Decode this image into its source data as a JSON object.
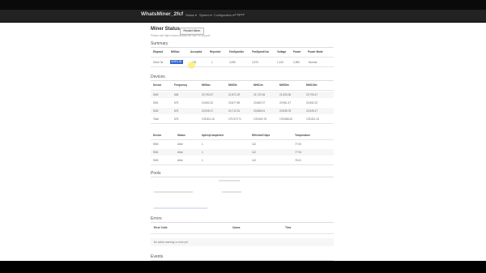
{
  "navbar": {
    "brand": "WhatsMiner_2fcf",
    "items": [
      "Status ▾",
      "System ▾",
      "Configuration ▾",
      "Logout"
    ]
  },
  "header": {
    "title": "Miner Status",
    "restart_label": "Restart Miner",
    "note": "Please visit https://www.whatsminer.com for support"
  },
  "summary": {
    "title": "Summary",
    "columns": [
      "Elapsed",
      "MHSav",
      "Accepted",
      "Rejected",
      "FanSpeedIn",
      "FanSpeedOut",
      "Voltage",
      "Power",
      "Power Mode"
    ],
    "row": [
      "0h1m 3s",
      "62901.81",
      "153",
      "1",
      "3,090",
      "3,570",
      "1,310",
      "3,380",
      "Normal"
    ]
  },
  "devices": {
    "title": "Devices",
    "columns": [
      "Device",
      "Frequency",
      "MHSav",
      "MHS5s",
      "MHS1m",
      "MHS5m",
      "MHS15m"
    ],
    "rows": [
      [
        "SM0",
        "648",
        "20,793.47",
        "21,871.29",
        "21,722.06",
        "21,533.36",
        "20,793.47"
      ],
      [
        "SM1",
        "675",
        "20,652.22",
        "20,877.89",
        "20,882.37",
        "20,961.47",
        "20,652.22"
      ],
      [
        "SM2",
        "675",
        "20,926.17",
        "20,712.31",
        "20,868.31",
        "20,835.78",
        "20,926.17"
      ],
      [
        "Total",
        "675",
        "178,811.16",
        "179,573.71",
        "178,804.76",
        "178,868.43",
        "178,811.16"
      ]
    ],
    "columns2": [
      "Device",
      "Status",
      "UpfreqCompleted",
      "EffectiveChips",
      "Temperature"
    ],
    "rows2": [
      [
        "SM0",
        "Alive",
        "1",
        "112",
        "77.00"
      ],
      [
        "SM1",
        "Alive",
        "1",
        "112",
        "77.94"
      ],
      [
        "SM2",
        "Alive",
        "1",
        "112",
        "76.31"
      ]
    ]
  },
  "pools": {
    "title": "Pools"
  },
  "errors": {
    "title": "Errors",
    "columns": [
      "Error Code",
      "Cause",
      "Time"
    ],
    "empty": "No active warning or error yet"
  },
  "events": {
    "title": "Events"
  }
}
